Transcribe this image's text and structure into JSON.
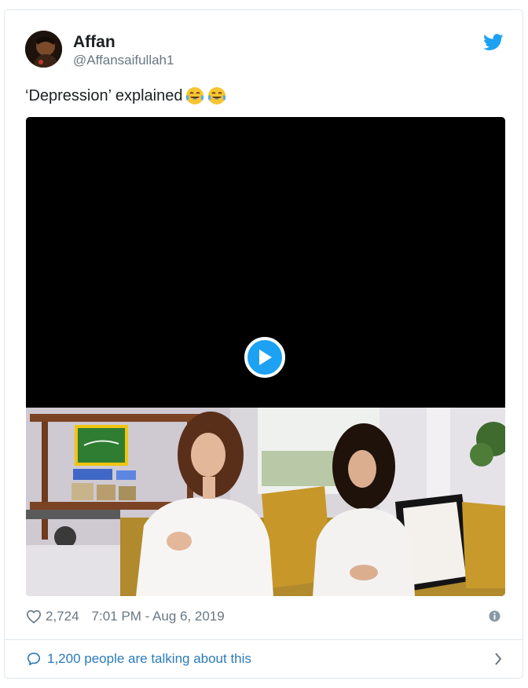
{
  "author": {
    "name": "Affan",
    "handle": "@Affansaifullah1"
  },
  "tweet": {
    "text": "‘Depression’ explained",
    "emojis": [
      "face-with-tears-of-joy-icon",
      "face-with-tears-of-joy-icon"
    ]
  },
  "media": {
    "type": "video",
    "play_icon": "play-icon"
  },
  "stats": {
    "likes": "2,724",
    "timestamp": "7:01 PM - Aug 6, 2019"
  },
  "footer": {
    "talking_label": "1,200 people are talking about this"
  },
  "colors": {
    "brand_blue": "#1da1f2",
    "link_blue": "#2b7bb9",
    "muted_text": "#697882",
    "border": "#e1e8ed"
  }
}
